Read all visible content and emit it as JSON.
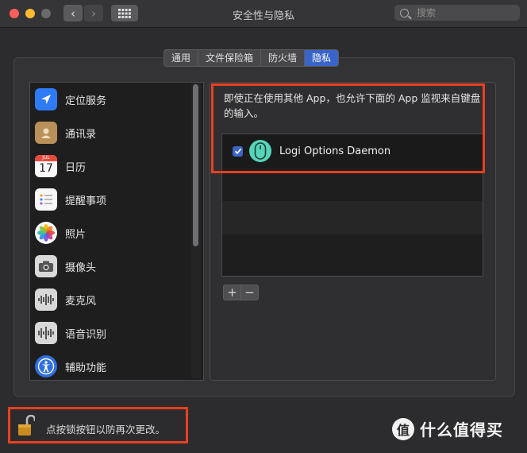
{
  "window": {
    "title": "安全性与隐私"
  },
  "toolbar": {
    "back": "‹",
    "forward": "›"
  },
  "search": {
    "placeholder": "搜索"
  },
  "tabs": [
    {
      "label": "通用",
      "active": false
    },
    {
      "label": "文件保险箱",
      "active": false
    },
    {
      "label": "防火墙",
      "active": false
    },
    {
      "label": "隐私",
      "active": true
    }
  ],
  "sidebar": {
    "items": [
      {
        "label": "定位服务",
        "icon": "location-icon"
      },
      {
        "label": "通讯录",
        "icon": "contacts-icon"
      },
      {
        "label": "日历",
        "icon": "calendar-icon",
        "icon_text_month": "JUL",
        "icon_text_day": "17"
      },
      {
        "label": "提醒事项",
        "icon": "reminders-icon"
      },
      {
        "label": "照片",
        "icon": "photos-icon"
      },
      {
        "label": "摄像头",
        "icon": "camera-icon"
      },
      {
        "label": "麦克风",
        "icon": "microphone-icon"
      },
      {
        "label": "语音识别",
        "icon": "speech-recognition-icon"
      },
      {
        "label": "辅助功能",
        "icon": "accessibility-icon"
      }
    ]
  },
  "detail": {
    "description": "即使正在使用其他 App，也允许下面的 App 监视来自键盘的输入。",
    "apps": [
      {
        "name": "Logi Options Daemon",
        "checked": true
      }
    ],
    "add_label": "+",
    "remove_label": "−"
  },
  "footer": {
    "lock_text": "点按锁按钮以防再次更改。"
  },
  "watermark": {
    "badge": "值",
    "text": "什么值得买"
  },
  "colors": {
    "accent": "#3a65c8",
    "highlight": "#e8401f"
  }
}
